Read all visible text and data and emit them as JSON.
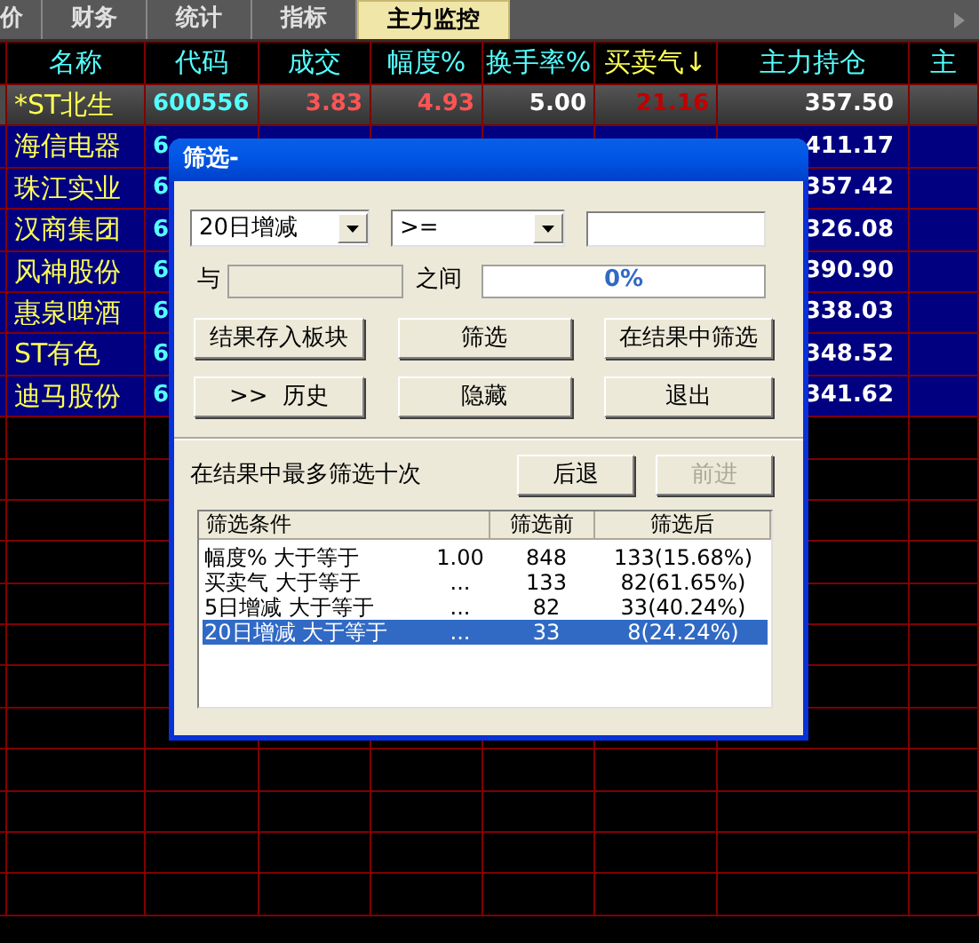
{
  "tabs": [
    {
      "label": "价",
      "selected": false
    },
    {
      "label": "财务",
      "selected": false
    },
    {
      "label": "统计",
      "selected": false
    },
    {
      "label": "指标",
      "selected": false
    },
    {
      "label": "主力监控",
      "selected": true
    }
  ],
  "columns": [
    {
      "label": "名称",
      "sorted": false
    },
    {
      "label": "代码",
      "sorted": false
    },
    {
      "label": "成交",
      "sorted": false
    },
    {
      "label": "幅度%",
      "sorted": false
    },
    {
      "label": "换手率%",
      "sorted": false
    },
    {
      "label": "买卖气↓",
      "sorted": true
    },
    {
      "label": "主力持仓",
      "sorted": false
    },
    {
      "label": "主",
      "sorted": false
    }
  ],
  "rows": [
    {
      "name": "*ST北生",
      "code": "600556",
      "volume": "3.83",
      "change": "4.93",
      "turnover": "5.00",
      "buy_sell": "21.16",
      "holding": "357.50",
      "selected": true
    },
    {
      "name": "海信电器",
      "code": "6",
      "holding": "411.17",
      "selected": false
    },
    {
      "name": "珠江实业",
      "code": "6",
      "holding": "357.42",
      "selected": false
    },
    {
      "name": "汉商集团",
      "code": "6",
      "holding": "326.08",
      "selected": false
    },
    {
      "name": "风神股份",
      "code": "6",
      "holding": "390.90",
      "selected": false
    },
    {
      "name": "惠泉啤酒",
      "code": "6",
      "holding": "338.03",
      "selected": false
    },
    {
      "name": "ST有色",
      "code": "6",
      "holding": "348.52",
      "selected": false
    },
    {
      "name": "迪马股份",
      "code": "6",
      "holding": "341.62",
      "selected": false
    }
  ],
  "dialog": {
    "title": "筛选-",
    "field": {
      "value": "20日增减"
    },
    "operator": {
      "value": ">="
    },
    "and_label": "与",
    "between_label": "之间",
    "progress": {
      "text": "0%",
      "level": 0
    },
    "buttons": [
      {
        "label": "结果存入板块",
        "disabled": false
      },
      {
        "label": "筛选",
        "disabled": false
      },
      {
        "label": "在结果中筛选",
        "disabled": false
      },
      {
        "label": ">>  历史",
        "disabled": false
      },
      {
        "label": "隐藏",
        "disabled": false
      },
      {
        "label": "退出",
        "disabled": false
      }
    ],
    "hint": "在结果中最多筛选十次",
    "nav_buttons": [
      {
        "label": "后退",
        "disabled": false
      },
      {
        "label": "前进",
        "disabled": true
      }
    ],
    "list": {
      "columns": [
        "筛选条件",
        "筛选前",
        "筛选后"
      ],
      "rows": [
        {
          "condition": "幅度% 大于等于",
          "value": "1.00",
          "before": "848",
          "after": "133(15.68%)",
          "selected": false
        },
        {
          "condition": "买卖气 大于等于",
          "value": "...",
          "before": "133",
          "after": "82(61.65%)",
          "selected": false
        },
        {
          "condition": "5日增减 大于等于",
          "value": "...",
          "before": "82",
          "after": "33(40.24%)",
          "selected": false
        },
        {
          "condition": "20日增减 大于等于",
          "value": "...",
          "before": "33",
          "after": "8(24.24%)",
          "selected": true
        }
      ]
    }
  }
}
